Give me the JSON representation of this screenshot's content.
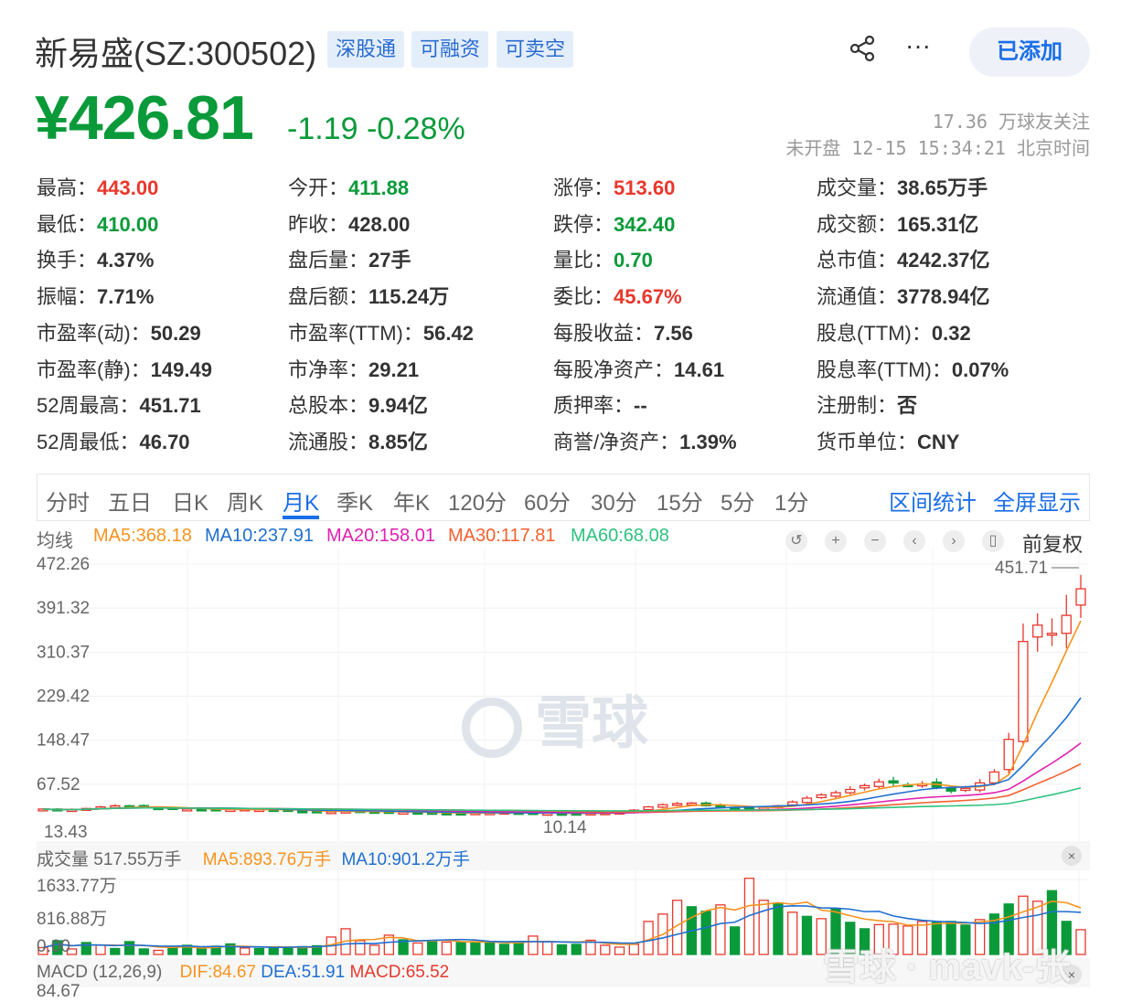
{
  "header": {
    "name": "新易盛(SZ:300502)",
    "tags": [
      "深股通",
      "可融资",
      "可卖空"
    ],
    "added_label": "已添加",
    "share_icon": "share-icon",
    "more_icon": "more-icon"
  },
  "quote": {
    "price": "¥426.81",
    "change": "-1.19 -0.28%",
    "followers": "17.36 万球友关注",
    "status": "未开盘 12-15 15:34:21 北京时间"
  },
  "colors": {
    "up": "#e8372c",
    "down": "#0a9a3a",
    "accent": "#1b6ee8"
  },
  "stats": [
    [
      {
        "k": "最高：",
        "v": "443.00",
        "c": "up"
      },
      {
        "k": "今开：",
        "v": "411.88",
        "c": "down"
      },
      {
        "k": "涨停：",
        "v": "513.60",
        "c": "up"
      },
      {
        "k": "成交量：",
        "v": "38.65万手",
        "c": ""
      }
    ],
    [
      {
        "k": "最低：",
        "v": "410.00",
        "c": "down"
      },
      {
        "k": "昨收：",
        "v": "428.00",
        "c": ""
      },
      {
        "k": "跌停：",
        "v": "342.40",
        "c": "down"
      },
      {
        "k": "成交额：",
        "v": "165.31亿",
        "c": ""
      }
    ],
    [
      {
        "k": "换手：",
        "v": "4.37%",
        "c": ""
      },
      {
        "k": "盘后量：",
        "v": "27手",
        "c": ""
      },
      {
        "k": "量比：",
        "v": "0.70",
        "c": "down"
      },
      {
        "k": "总市值：",
        "v": "4242.37亿",
        "c": ""
      }
    ],
    [
      {
        "k": "振幅：",
        "v": "7.71%",
        "c": ""
      },
      {
        "k": "盘后额：",
        "v": "115.24万",
        "c": ""
      },
      {
        "k": "委比：",
        "v": "45.67%",
        "c": "up"
      },
      {
        "k": "流通值：",
        "v": "3778.94亿",
        "c": ""
      }
    ],
    [
      {
        "k": "市盈率(动)：",
        "v": "50.29",
        "c": ""
      },
      {
        "k": "市盈率(TTM)：",
        "v": "56.42",
        "c": ""
      },
      {
        "k": "每股收益：",
        "v": "7.56",
        "c": ""
      },
      {
        "k": "股息(TTM)：",
        "v": "0.32",
        "c": ""
      }
    ],
    [
      {
        "k": "市盈率(静)：",
        "v": "149.49",
        "c": ""
      },
      {
        "k": "市净率：",
        "v": "29.21",
        "c": ""
      },
      {
        "k": "每股净资产：",
        "v": "14.61",
        "c": ""
      },
      {
        "k": "股息率(TTM)：",
        "v": "0.07%",
        "c": ""
      }
    ],
    [
      {
        "k": "52周最高：",
        "v": "451.71",
        "c": ""
      },
      {
        "k": "总股本：",
        "v": "9.94亿",
        "c": ""
      },
      {
        "k": "质押率：",
        "v": "--",
        "c": ""
      },
      {
        "k": "注册制：",
        "v": "否",
        "c": ""
      }
    ],
    [
      {
        "k": "52周最低：",
        "v": "46.70",
        "c": ""
      },
      {
        "k": "流通股：",
        "v": "8.85亿",
        "c": ""
      },
      {
        "k": "商誉/净资产：",
        "v": "1.39%",
        "c": ""
      },
      {
        "k": "货币单位：",
        "v": "CNY",
        "c": ""
      }
    ]
  ],
  "tabs": [
    "分时",
    "五日",
    "日K",
    "周K",
    "月K",
    "季K",
    "年K",
    "120分",
    "60分",
    "30分",
    "15分",
    "5分",
    "1分"
  ],
  "active_tab": "月K",
  "tab_actions": [
    "区间统计",
    "全屏显示"
  ],
  "ma_legend": {
    "title": "均线",
    "items": [
      {
        "t": "MA5:368.18",
        "c": "#f7931e"
      },
      {
        "t": "MA10:237.91",
        "c": "#1f6fd1"
      },
      {
        "t": "MA20:158.01",
        "c": "#e020b0"
      },
      {
        "t": "MA30:117.81",
        "c": "#f56030"
      },
      {
        "t": "MA60:68.08",
        "c": "#2ec27e"
      }
    ]
  },
  "chart_controls": [
    "↺",
    "+",
    "−",
    "‹",
    "›",
    "▯"
  ],
  "adjust_label": "前复权",
  "watermark": "雪球",
  "footer_watermark": "雪球 · mavk-张",
  "chart_data": {
    "type": "candlestick",
    "yticks": [
      "472.26",
      "391.32",
      "310.37",
      "229.42",
      "148.47",
      "67.52"
    ],
    "ylim": [
      -13.43,
      472.26
    ],
    "max_label": "451.71",
    "min_label": "13.43",
    "local_min_label": "10.14",
    "closes": [
      22,
      20,
      21,
      23,
      26,
      28,
      27,
      25,
      24,
      23,
      22,
      21,
      20,
      21,
      22,
      21,
      20,
      19,
      18,
      17,
      17,
      18,
      18,
      17,
      16,
      16,
      15,
      15,
      14,
      14,
      15,
      15,
      16,
      15,
      14,
      14,
      13.5,
      14,
      14.5,
      15,
      16,
      20,
      26,
      30,
      32,
      33,
      28,
      26,
      24,
      23,
      25,
      28,
      35,
      42,
      48,
      52,
      58,
      65,
      72,
      70,
      66,
      68,
      62,
      55,
      60,
      70,
      90,
      150,
      330,
      360,
      345,
      378,
      426.81
    ],
    "volume": {
      "header": "成交量 517.55万手",
      "ma5": "MA5:893.76万手",
      "ma10": "MA10:901.2万手",
      "yticks": [
        "1633.77万",
        "816.88万",
        "0.00"
      ],
      "max": 1633.77,
      "values": [
        150,
        300,
        120,
        260,
        200,
        130,
        280,
        120,
        90,
        150,
        200,
        140,
        180,
        230,
        140,
        130,
        150,
        160,
        170,
        190,
        380,
        560,
        300,
        200,
        420,
        320,
        250,
        300,
        270,
        260,
        280,
        260,
        220,
        250,
        400,
        280,
        210,
        220,
        310,
        200,
        160,
        220,
        720,
        880,
        1180,
        1040,
        940,
        1080,
        600,
        1660,
        1180,
        1120,
        920,
        830,
        780,
        990,
        700,
        560,
        650,
        660,
        620,
        720,
        700,
        720,
        640,
        760,
        880,
        1100,
        1270,
        1160,
        1390,
        720,
        540
      ],
      "down": [
        1,
        3,
        5,
        6,
        7,
        9,
        10,
        11,
        12,
        13,
        15,
        16,
        17,
        18,
        19,
        25,
        27,
        29,
        30,
        31,
        32,
        33,
        36,
        37,
        45,
        46,
        48,
        51,
        53,
        55,
        56,
        57,
        62,
        63,
        64,
        66,
        67,
        70,
        71
      ]
    },
    "macd": {
      "header": "MACD (12,26,9)",
      "dif": "DIF:84.67",
      "dea": "DEA:51.91",
      "macd": "MACD:65.52",
      "ytop": "84.67"
    }
  }
}
